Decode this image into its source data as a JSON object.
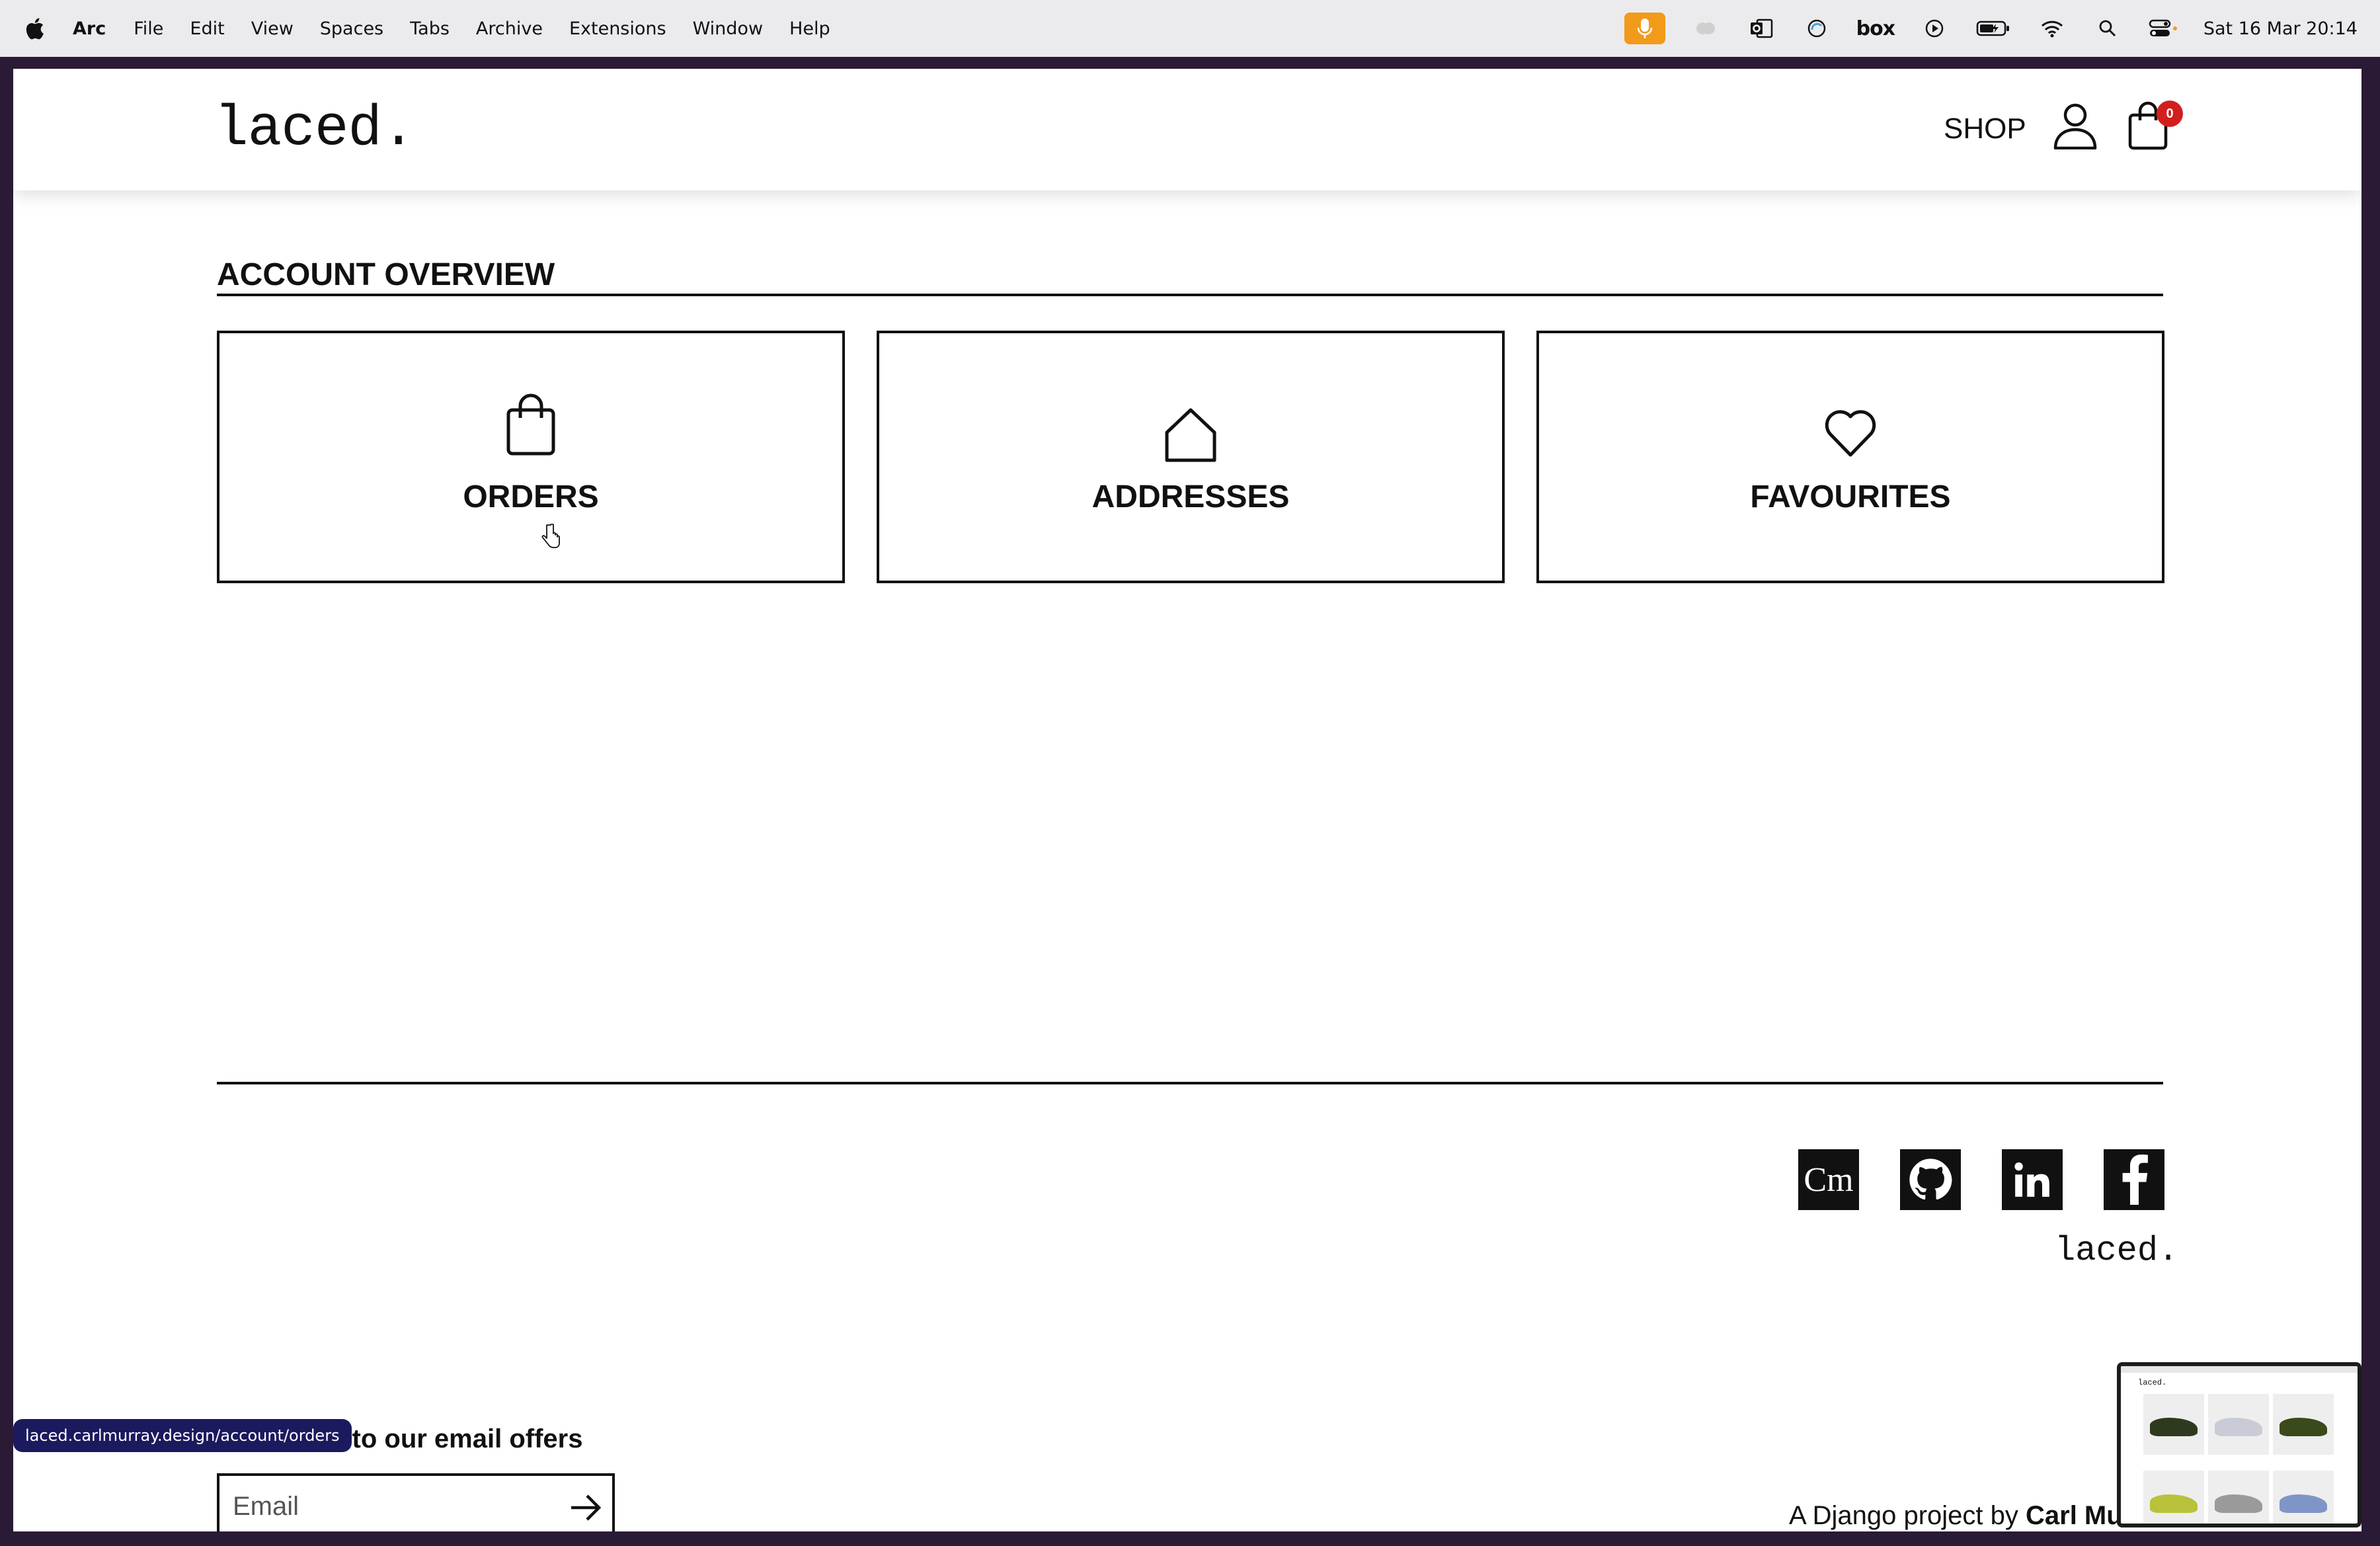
{
  "menubar": {
    "app_name": "Arc",
    "items": [
      "File",
      "Edit",
      "View",
      "Spaces",
      "Tabs",
      "Archive",
      "Extensions",
      "Window",
      "Help"
    ],
    "tray_icons": [
      "microphone-icon",
      "cloud-icon",
      "outlook-icon",
      "sync-icon",
      "box-icon",
      "play-icon",
      "battery-icon",
      "wifi-icon",
      "spotlight-search-icon",
      "control-center-icon"
    ],
    "box_label": "box",
    "clock": "Sat 16 Mar  20:14",
    "accent_color": "#f29a1a"
  },
  "header": {
    "logo": "laced.",
    "shop_label": "SHOP",
    "cart_count": "0",
    "badge_color": "#d11f1f"
  },
  "account": {
    "title": "ACCOUNT OVERVIEW",
    "cards": [
      {
        "label": "ORDERS",
        "icon": "shopping-bag-icon"
      },
      {
        "label": "ADDRESSES",
        "icon": "house-icon"
      },
      {
        "label": "FAVOURITES",
        "icon": "heart-icon"
      }
    ]
  },
  "footer": {
    "social": [
      {
        "name": "carl-murray-site",
        "label": "Cm"
      },
      {
        "name": "github",
        "icon": "github-icon"
      },
      {
        "name": "linkedin",
        "label": "in",
        "icon": "linkedin-icon"
      },
      {
        "name": "facebook",
        "label": "f",
        "icon": "facebook-icon"
      }
    ],
    "logo": "laced.",
    "subscribe_title": "Subscribe to our email offers",
    "email_placeholder": "Email",
    "credit_prefix": "A Django project by ",
    "credit_name": "Carl Mu"
  },
  "browser": {
    "status_url": "laced.carlmurray.design/account/orders",
    "preview_logo": "laced."
  }
}
